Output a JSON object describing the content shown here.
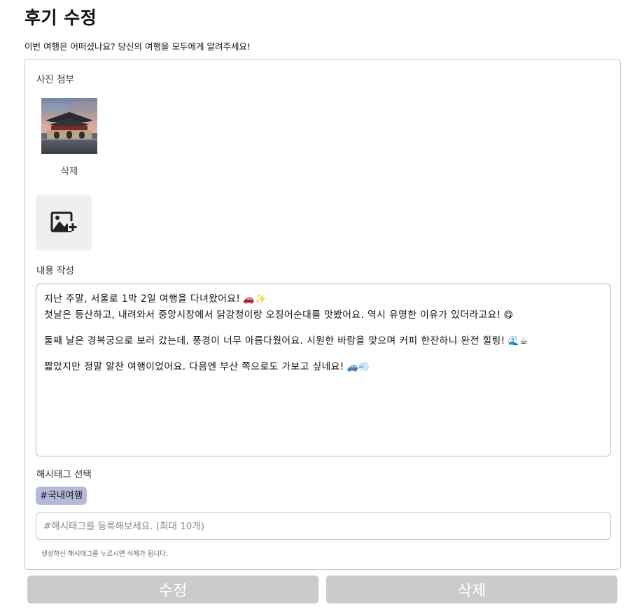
{
  "header": {
    "title": "후기 수정",
    "subtitle": "이번 여행은 어떠셨나요? 당신의 여행을 모두에게 알려주세요!"
  },
  "photo_section": {
    "label": "사진 첨부",
    "delete_label": "삭제"
  },
  "content_section": {
    "label": "내용 작성",
    "lines": [
      "지난 주말, 서울로 1박 2일 여행을 다녀왔어요!",
      "첫날은 등산하고, 내려와서 중앙시장에서 닭강정이랑 오징어순대를 맛봤어요. 역시 유명한 이유가 있더라고요!",
      "둘째 날은 경복궁으로 보러 갔는데, 풍경이 너무 아름다웠어요. 시원한 바람을 맞으며 커피 한잔하니 완전 힐링!",
      "짧았지만 정말 알찬 여행이었어요. 다음엔 부산 쪽으로도 가보고 싶네요!"
    ],
    "emojis": [
      "🚗✨",
      "😋",
      "🌊☕",
      "🚙💨"
    ]
  },
  "hashtag_section": {
    "label": "해시태그 선택",
    "selected": [
      "#국내여행"
    ],
    "input_placeholder": "#해시태그를 등록해보세요. (최대 10개)",
    "hint": "생성하신 해시태그를 누르시면 삭제가 됩니다."
  },
  "buttons": {
    "edit_label": "수정",
    "delete_label": "삭제"
  },
  "colors": {
    "button_bg": "#cbcbcb",
    "chip_bg": "#b7b9dc",
    "card_border": "#c9c9c9"
  },
  "icons": {
    "add_photo": "add-photo-icon"
  }
}
